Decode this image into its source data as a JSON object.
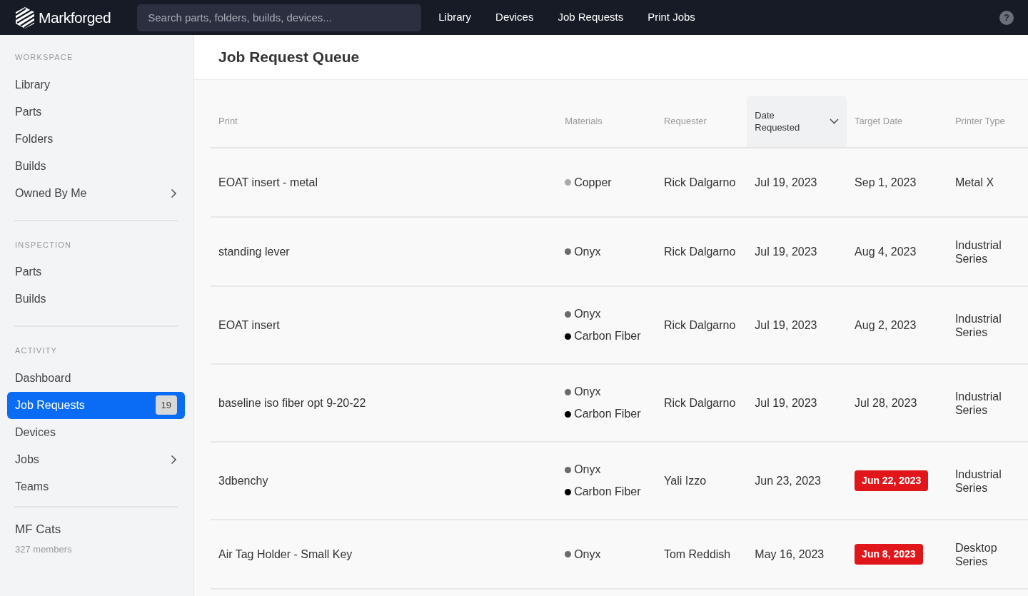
{
  "topbar": {
    "brand": "Markforged",
    "search": {
      "placeholder": "Search parts, folders, builds, devices..."
    },
    "nav": [
      {
        "label": "Library"
      },
      {
        "label": "Devices"
      },
      {
        "label": "Job Requests"
      },
      {
        "label": "Print Jobs"
      }
    ],
    "help": "?"
  },
  "sidebar": {
    "sections": [
      {
        "heading": "WORKSPACE",
        "items": [
          {
            "label": "Library",
            "selected": false
          },
          {
            "label": "Parts",
            "selected": false
          },
          {
            "label": "Folders",
            "selected": false
          },
          {
            "label": "Builds",
            "selected": false
          },
          {
            "label": "Owned By Me",
            "selected": false,
            "expandable": true
          }
        ]
      },
      {
        "heading": "INSPECTION",
        "items": [
          {
            "label": "Parts",
            "selected": false
          },
          {
            "label": "Builds",
            "selected": false
          }
        ]
      },
      {
        "heading": "ACTIVITY",
        "items": [
          {
            "label": "Dashboard",
            "selected": false
          },
          {
            "label": "Job Requests",
            "selected": true,
            "count": "19"
          },
          {
            "label": "Devices",
            "selected": false
          },
          {
            "label": "Jobs",
            "selected": false,
            "expandable": true
          },
          {
            "label": "Teams",
            "selected": false
          }
        ]
      }
    ],
    "team": {
      "name": "MF Cats",
      "members": "327 members"
    }
  },
  "page": {
    "title": "Job Request Queue"
  },
  "table": {
    "columns": [
      {
        "label": "Print",
        "sorted": false
      },
      {
        "label": "Materials",
        "sorted": false
      },
      {
        "label": "Requester",
        "sorted": false
      },
      {
        "label": "Date Requested",
        "sorted": true
      },
      {
        "label": "Target Date",
        "sorted": false
      },
      {
        "label": "Printer Type",
        "sorted": false
      }
    ],
    "rows": [
      {
        "print": "EOAT insert - metal",
        "materials": [
          {
            "name": "Copper",
            "color": "#a9a9a9"
          }
        ],
        "requester": "Rick Dalgarno",
        "date_requested": "Jul 19, 2023",
        "target_date": "Sep 1, 2023",
        "overdue": false,
        "printer_type": "Metal X"
      },
      {
        "print": "standing lever",
        "materials": [
          {
            "name": "Onyx",
            "color": "#6b6b6b"
          }
        ],
        "requester": "Rick Dalgarno",
        "date_requested": "Jul 19, 2023",
        "target_date": "Aug 4, 2023",
        "overdue": false,
        "printer_type": "Industrial Series"
      },
      {
        "print": "EOAT insert",
        "materials": [
          {
            "name": "Onyx",
            "color": "#6b6b6b"
          },
          {
            "name": "Carbon Fiber",
            "color": "#000000"
          }
        ],
        "requester": "Rick Dalgarno",
        "date_requested": "Jul 19, 2023",
        "target_date": "Aug 2, 2023",
        "overdue": false,
        "printer_type": "Industrial Series"
      },
      {
        "print": "baseline iso fiber opt 9-20-22",
        "materials": [
          {
            "name": "Onyx",
            "color": "#6b6b6b"
          },
          {
            "name": "Carbon Fiber",
            "color": "#000000"
          }
        ],
        "requester": "Rick Dalgarno",
        "date_requested": "Jul 19, 2023",
        "target_date": "Jul 28, 2023",
        "overdue": false,
        "printer_type": "Industrial Series"
      },
      {
        "print": "3dbenchy",
        "materials": [
          {
            "name": "Onyx",
            "color": "#6b6b6b"
          },
          {
            "name": "Carbon Fiber",
            "color": "#000000"
          }
        ],
        "requester": "Yali Izzo",
        "date_requested": "Jun 23, 2023",
        "target_date": "Jun 22, 2023",
        "overdue": true,
        "printer_type": "Industrial Series"
      },
      {
        "print": "Air Tag Holder - Small Key",
        "materials": [
          {
            "name": "Onyx",
            "color": "#6b6b6b"
          }
        ],
        "requester": "Tom Reddish",
        "date_requested": "May 16, 2023",
        "target_date": "Jun 8, 2023",
        "overdue": true,
        "printer_type": "Desktop Series"
      }
    ]
  }
}
